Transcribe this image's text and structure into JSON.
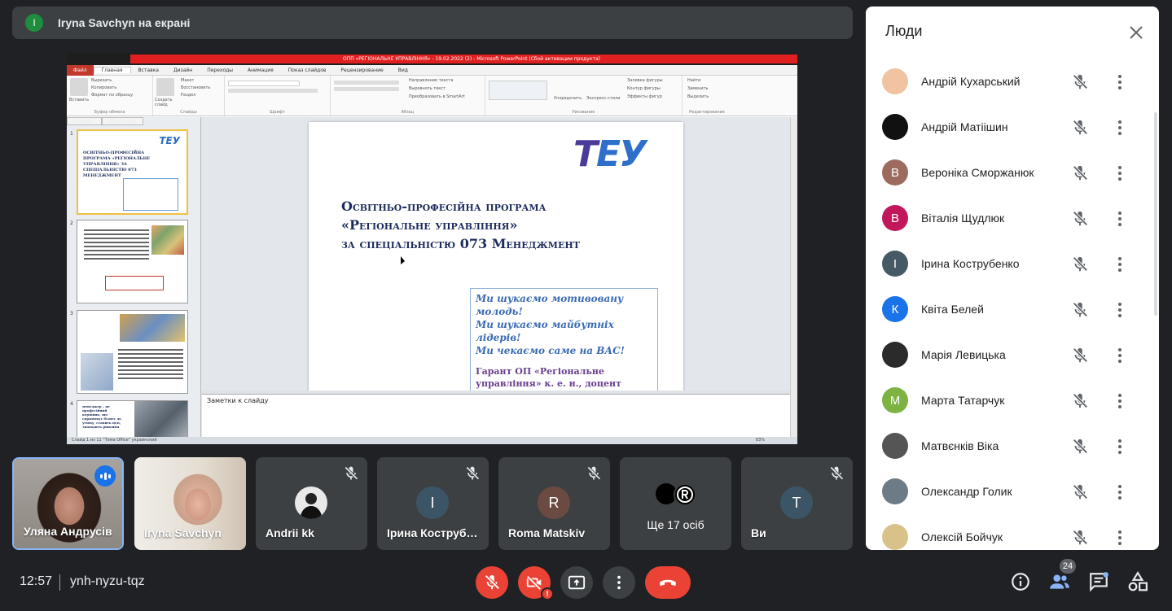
{
  "presenter_banner": {
    "initial": "I",
    "text": "Iryna Savchyn на екрані"
  },
  "powerpoint": {
    "window_title": "ОПП «РЕГІОНАЛЬНЕ УПРАВЛІННЯ» - 19.02.2022 (2) - Microsoft PowerPoint (Сбой активации продукта)",
    "tabs": [
      "Файл",
      "Главная",
      "Вставка",
      "Дизайн",
      "Переходы",
      "Анимация",
      "Показ слайдов",
      "Рецензирование",
      "Вид"
    ],
    "ribbon_groups": [
      "Буфер обмена",
      "Слайды",
      "Шрифт",
      "Абзац",
      "Рисование",
      "Редактирование"
    ],
    "ribbon_buttons": {
      "paste": "Вставить",
      "cut": "Вырезать",
      "copy": "Копировать",
      "format_painter": "Формат по образцу",
      "new_slide": "Создать слайд",
      "layout": "Макет",
      "reset": "Восстановить",
      "section": "Раздел",
      "text_direction": "Направление текста",
      "align_text": "Выровнять текст",
      "smartart": "Преобразовать в SmartArt",
      "arrange": "Упорядочить",
      "quick_styles": "Экспресс-стили",
      "shape_fill": "Заливка фигуры",
      "shape_outline": "Контур фигуры",
      "shape_effects": "Эффекты фигур",
      "find": "Найти",
      "replace": "Заменить",
      "select": "Выделить"
    },
    "pane_tabs": [
      "Слайды",
      "Структура"
    ],
    "slide_numbers": [
      "1",
      "2",
      "3",
      "4"
    ],
    "thumb1": {
      "title": "ОСВІТНЬО-ПРОФЕСІЙНА ПРОГРАМА «РЕГІОНАЛЬНЕ УПРАВЛІННЯ» ЗА СПЕЦІАЛЬНІСТЮ 073 МЕНЕДЖМЕНТ",
      "logo": "ТЕУ"
    },
    "thumb4_text": "менеджер – це професійний керівник, що спрямовує бізнес до успіху, ставить цілі, знаходить рішення",
    "slide": {
      "logo_t": "Т",
      "logo_rest": "ЕУ",
      "title_lines": [
        "Освітньо-професійна програма",
        "«Регіональне управління»",
        "за спеціальністю 073 Менеджмент"
      ],
      "tagline_lines": [
        "Ми шукаємо мотивовану молодь!",
        "Ми шукаємо майбутніх лідерів!",
        "Ми чекаємо саме на ВАС!"
      ],
      "guarantor": "Гарант ОП «Регіональне управління» к. е. н., доцент кафедри ТЕУ – Андрусів У. Я."
    },
    "notes_placeholder": "Заметки к слайду",
    "status": "Слайд 1 из 11    \"Тема Office\"    украинский",
    "zoom": "83%"
  },
  "tiles": [
    {
      "name": "Уляна Андрусів",
      "speaking": true
    },
    {
      "name": "Iryna Savchyn"
    },
    {
      "name": "Andrii kk",
      "muted": true
    },
    {
      "name": "Ірина Кострубенко",
      "initial": "І",
      "muted": true,
      "color": "#3b5566"
    },
    {
      "name": "Roma Matskiv",
      "initial": "R",
      "muted": true,
      "color": "#6b4a42"
    },
    {
      "more": "Ще 17 осіб"
    },
    {
      "name": "Ви",
      "initial": "T",
      "muted": true,
      "color": "#3b5566"
    }
  ],
  "people_panel": {
    "title": "Люди",
    "people": [
      {
        "name": "Андрій Кухарський",
        "initial": "",
        "color": "#f2c3a0"
      },
      {
        "name": "Андрій Матіішин",
        "initial": "",
        "color": "#111111"
      },
      {
        "name": "Вероніка Сморжанюк",
        "initial": "В",
        "color": "#9c6b5e"
      },
      {
        "name": "Віталія Щудлюк",
        "initial": "В",
        "color": "#c2185b"
      },
      {
        "name": "Ірина Кострубенко",
        "initial": "І",
        "color": "#455a64"
      },
      {
        "name": "Квіта Белей",
        "initial": "К",
        "color": "#1a73e8"
      },
      {
        "name": "Марія Левицька",
        "initial": "",
        "color": "#2b2b2b"
      },
      {
        "name": "Марта Татарчук",
        "initial": "М",
        "color": "#7cb342"
      },
      {
        "name": "Матвєнків Віка",
        "initial": "",
        "color": "#555555"
      },
      {
        "name": "Олександр Голик",
        "initial": "",
        "color": "#6d7b86"
      },
      {
        "name": "Олексій Бойчук",
        "initial": "",
        "color": "#d8c28a"
      }
    ]
  },
  "bottom_bar": {
    "time": "12:57",
    "meeting_code": "ynh-nyzu-tqz",
    "participants_count": "24"
  },
  "colors": {
    "background": "#202124",
    "tile": "#3c4043",
    "danger": "#ea4335",
    "accent": "#1a73e8"
  }
}
